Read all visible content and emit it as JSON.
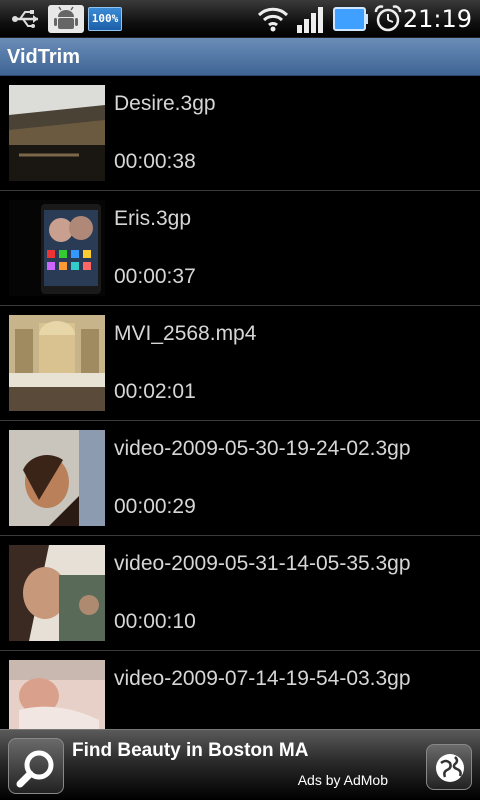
{
  "status_bar": {
    "battery_notification": "100%",
    "time": "21:19",
    "icons": [
      "usb-icon",
      "debug-android-icon",
      "battery-notification-icon",
      "wifi-icon",
      "signal-icon",
      "battery-icon",
      "alarm-icon"
    ]
  },
  "app": {
    "title": "VidTrim"
  },
  "videos": [
    {
      "name": "Desire.3gp",
      "duration": "00:00:38"
    },
    {
      "name": "Eris.3gp",
      "duration": "00:00:37"
    },
    {
      "name": "MVI_2568.mp4",
      "duration": "00:02:01"
    },
    {
      "name": "video-2009-05-30-19-24-02.3gp",
      "duration": "00:00:29"
    },
    {
      "name": "video-2009-05-31-14-05-35.3gp",
      "duration": "00:00:10"
    },
    {
      "name": "video-2009-07-14-19-54-03.3gp",
      "duration": ""
    }
  ],
  "ad": {
    "title": "Find Beauty in Boston MA",
    "subtitle": "Ads by AdMob",
    "left_icon": "search-icon",
    "right_icon": "globe-icon"
  },
  "colors": {
    "titlebar": "#4f76a6",
    "background": "#000000",
    "text": "#d6d6d6"
  }
}
